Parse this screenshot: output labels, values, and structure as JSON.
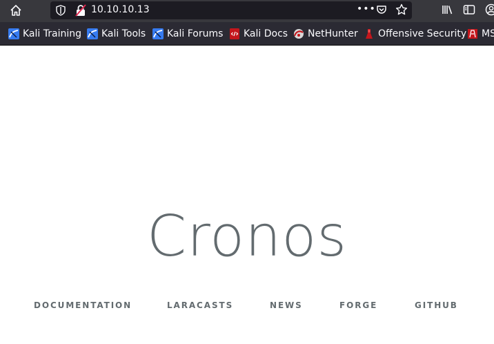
{
  "browser": {
    "url": "10.10.10.13",
    "page_actions_icon": "dots-icon",
    "icons": [
      "home-icon",
      "shield-icon",
      "insecure-lock-icon",
      "pocket-icon",
      "star-icon",
      "library-icon",
      "sidebar-icon",
      "account-icon"
    ]
  },
  "bookmarks": [
    {
      "label": "Kali Training",
      "icon": "kali-icon"
    },
    {
      "label": "Kali Tools",
      "icon": "kali-icon"
    },
    {
      "label": "Kali Forums",
      "icon": "kali-icon"
    },
    {
      "label": "Kali Docs",
      "icon": "kali-docs-icon"
    },
    {
      "label": "NetHunter",
      "icon": "nethunter-icon"
    },
    {
      "label": "Offensive Security",
      "icon": "offsec-icon"
    },
    {
      "label": "MS",
      "icon": "offsec-icon"
    }
  ],
  "page": {
    "title": "Cronos",
    "links": [
      "Documentation",
      "Laracasts",
      "News",
      "Forge",
      "GitHub"
    ]
  },
  "colors": {
    "toolbar": "#38383d",
    "bookmarks_bar": "#2b2a33",
    "text": "#636b6f",
    "url_field": "#1c1b22"
  }
}
